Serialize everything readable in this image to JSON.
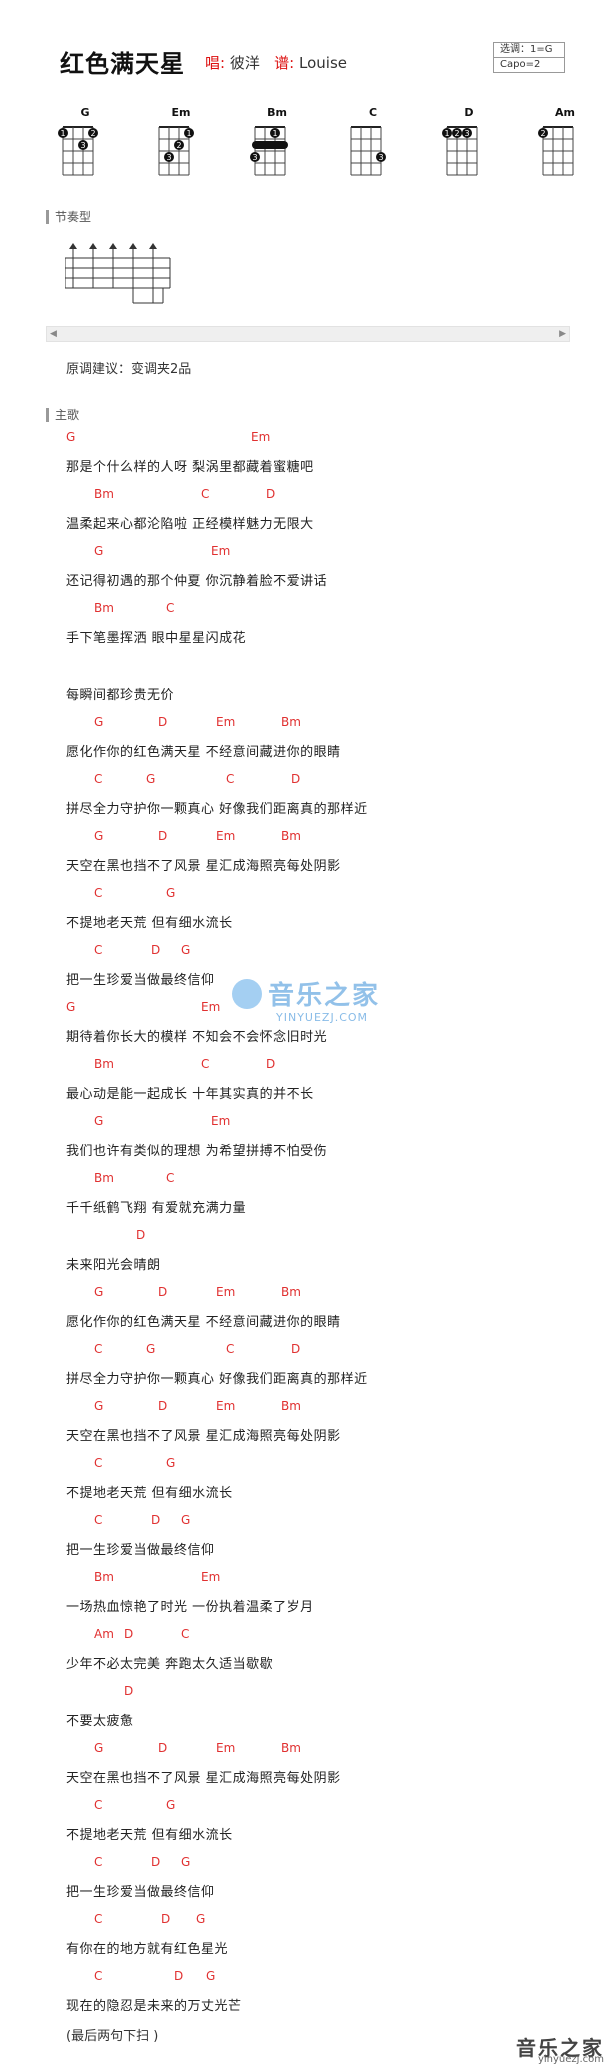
{
  "song": {
    "title": "红色满天星",
    "singer_label": "唱:",
    "singer": "彼洋",
    "score_label": "谱:",
    "scorer": "Louise"
  },
  "key_box": {
    "key": "选调：1=G",
    "capo": "Capo=2"
  },
  "chord_diagrams": [
    {
      "name": "G",
      "dots": [
        {
          "string": 1,
          "fret": 1,
          "finger": "1"
        },
        {
          "string": 4,
          "fret": 1,
          "finger": "2"
        },
        {
          "string": 3,
          "fret": 2,
          "finger": "3"
        }
      ],
      "barre": false
    },
    {
      "name": "Em",
      "dots": [
        {
          "string": 4,
          "fret": 1,
          "finger": "1"
        },
        {
          "string": 3,
          "fret": 2,
          "finger": "2"
        },
        {
          "string": 2,
          "fret": 3,
          "finger": "3"
        }
      ],
      "barre": false
    },
    {
      "name": "Bm",
      "dots": [
        {
          "string": 3,
          "fret": 1,
          "finger": "1"
        },
        {
          "string": 1,
          "fret": 3,
          "finger": "3"
        }
      ],
      "barre": true
    },
    {
      "name": "C",
      "dots": [
        {
          "string": 4,
          "fret": 3,
          "finger": "3"
        }
      ],
      "barre": false
    },
    {
      "name": "D",
      "dots": [
        {
          "string": 1,
          "fret": 1,
          "finger": "1"
        },
        {
          "string": 2,
          "fret": 1,
          "finger": "2"
        },
        {
          "string": 3,
          "fret": 1,
          "finger": "3"
        }
      ],
      "barre": false
    },
    {
      "name": "Am",
      "dots": [
        {
          "string": 1,
          "fret": 1,
          "finger": "2"
        }
      ],
      "barre": false
    }
  ],
  "sections": {
    "rhythm_label": "节奏型",
    "main_label": "主歌"
  },
  "suggestion": "原调建议：变调夹2品",
  "lines": [
    {
      "lyric": "那是个什么样的人呀  梨涡里都藏着蜜糖吧",
      "chords": [
        {
          "c": "G",
          "pos": 0
        },
        {
          "c": "Em",
          "pos": 185
        }
      ]
    },
    {
      "lyric": "温柔起来心都沦陷啦  正经模样魅力无限大",
      "chords": [
        {
          "c": "Bm",
          "pos": 28
        },
        {
          "c": "C",
          "pos": 135
        },
        {
          "c": "D",
          "pos": 200
        }
      ]
    },
    {
      "lyric": "还记得初遇的那个仲夏  你沉静着脸不爱讲话",
      "chords": [
        {
          "c": "G",
          "pos": 28
        },
        {
          "c": "Em",
          "pos": 145
        }
      ]
    },
    {
      "lyric": "手下笔墨挥洒  眼中星星闪成花",
      "chords": [
        {
          "c": "Bm",
          "pos": 28
        },
        {
          "c": "C",
          "pos": 100
        }
      ]
    },
    {
      "lyric": "每瞬间都珍贵无价",
      "chords": []
    },
    {
      "lyric": "愿化作你的红色满天星  不经意间藏进你的眼睛",
      "chords": [
        {
          "c": "G",
          "pos": 28
        },
        {
          "c": "D",
          "pos": 92
        },
        {
          "c": "Em",
          "pos": 150
        },
        {
          "c": "Bm",
          "pos": 215
        }
      ]
    },
    {
      "lyric": "拼尽全力守护你一颗真心  好像我们距离真的那样近",
      "chords": [
        {
          "c": "C",
          "pos": 28
        },
        {
          "c": "G",
          "pos": 80
        },
        {
          "c": "C",
          "pos": 160
        },
        {
          "c": "D",
          "pos": 225
        }
      ]
    },
    {
      "lyric": "天空在黑也挡不了风景  星汇成海照亮每处阴影",
      "chords": [
        {
          "c": "G",
          "pos": 28
        },
        {
          "c": "D",
          "pos": 92
        },
        {
          "c": "Em",
          "pos": 150
        },
        {
          "c": "Bm",
          "pos": 215
        }
      ]
    },
    {
      "lyric": "不提地老天荒  但有细水流长",
      "chords": [
        {
          "c": "C",
          "pos": 28
        },
        {
          "c": "G",
          "pos": 100
        }
      ]
    },
    {
      "lyric": "把一生珍爱当做最终信仰",
      "chords": [
        {
          "c": "C",
          "pos": 28
        },
        {
          "c": "D",
          "pos": 85
        },
        {
          "c": "G",
          "pos": 115
        }
      ]
    },
    {
      "lyric": "期待着你长大的模样  不知会不会怀念旧时光",
      "chords": [
        {
          "c": "G",
          "pos": 0
        },
        {
          "c": "Em",
          "pos": 135
        }
      ]
    },
    {
      "lyric": "最心动是能一起成长  十年其实真的并不长",
      "chords": [
        {
          "c": "Bm",
          "pos": 28
        },
        {
          "c": "C",
          "pos": 135
        },
        {
          "c": "D",
          "pos": 200
        }
      ]
    },
    {
      "lyric": "我们也许有类似的理想  为希望拼搏不怕受伤",
      "chords": [
        {
          "c": "G",
          "pos": 28
        },
        {
          "c": "Em",
          "pos": 145
        }
      ]
    },
    {
      "lyric": "千千纸鹤飞翔  有爱就充满力量",
      "chords": [
        {
          "c": "Bm",
          "pos": 28
        },
        {
          "c": "C",
          "pos": 100
        }
      ]
    },
    {
      "lyric": "未来阳光会晴朗",
      "chords": [
        {
          "c": "D",
          "pos": 70
        }
      ]
    },
    {
      "lyric": "愿化作你的红色满天星  不经意间藏进你的眼睛",
      "chords": [
        {
          "c": "G",
          "pos": 28
        },
        {
          "c": "D",
          "pos": 92
        },
        {
          "c": "Em",
          "pos": 150
        },
        {
          "c": "Bm",
          "pos": 215
        }
      ]
    },
    {
      "lyric": "拼尽全力守护你一颗真心  好像我们距离真的那样近",
      "chords": [
        {
          "c": "C",
          "pos": 28
        },
        {
          "c": "G",
          "pos": 80
        },
        {
          "c": "C",
          "pos": 160
        },
        {
          "c": "D",
          "pos": 225
        }
      ]
    },
    {
      "lyric": "天空在黑也挡不了风景  星汇成海照亮每处阴影",
      "chords": [
        {
          "c": "G",
          "pos": 28
        },
        {
          "c": "D",
          "pos": 92
        },
        {
          "c": "Em",
          "pos": 150
        },
        {
          "c": "Bm",
          "pos": 215
        }
      ]
    },
    {
      "lyric": "不提地老天荒  但有细水流长",
      "chords": [
        {
          "c": "C",
          "pos": 28
        },
        {
          "c": "G",
          "pos": 100
        }
      ]
    },
    {
      "lyric": "把一生珍爱当做最终信仰",
      "chords": [
        {
          "c": "C",
          "pos": 28
        },
        {
          "c": "D",
          "pos": 85
        },
        {
          "c": "G",
          "pos": 115
        }
      ]
    },
    {
      "lyric": "一场热血惊艳了时光  一份执着温柔了岁月",
      "chords": [
        {
          "c": "Bm",
          "pos": 28
        },
        {
          "c": "Em",
          "pos": 135
        }
      ]
    },
    {
      "lyric": "少年不必太完美  奔跑太久适当歇歇",
      "chords": [
        {
          "c": "Am",
          "pos": 28
        },
        {
          "c": "D",
          "pos": 58
        },
        {
          "c": "C",
          "pos": 115
        }
      ]
    },
    {
      "lyric": "不要太疲惫",
      "chords": [
        {
          "c": "D",
          "pos": 58
        }
      ]
    },
    {
      "lyric": "天空在黑也挡不了风景  星汇成海照亮每处阴影",
      "chords": [
        {
          "c": "G",
          "pos": 28
        },
        {
          "c": "D",
          "pos": 92
        },
        {
          "c": "Em",
          "pos": 150
        },
        {
          "c": "Bm",
          "pos": 215
        }
      ]
    },
    {
      "lyric": "不提地老天荒  但有细水流长",
      "chords": [
        {
          "c": "C",
          "pos": 28
        },
        {
          "c": "G",
          "pos": 100
        }
      ]
    },
    {
      "lyric": "把一生珍爱当做最终信仰",
      "chords": [
        {
          "c": "C",
          "pos": 28
        },
        {
          "c": "D",
          "pos": 85
        },
        {
          "c": "G",
          "pos": 115
        }
      ]
    },
    {
      "lyric": "有你在的地方就有红色星光",
      "chords": [
        {
          "c": "C",
          "pos": 28
        },
        {
          "c": "D",
          "pos": 95
        },
        {
          "c": "G",
          "pos": 130
        }
      ]
    },
    {
      "lyric": "现在的隐忍是未来的万丈光芒",
      "chords": [
        {
          "c": "C",
          "pos": 28
        },
        {
          "c": "D",
          "pos": 108
        },
        {
          "c": "G",
          "pos": 140
        }
      ]
    }
  ],
  "ending": "(最后两句下扫 )",
  "watermark": {
    "text": "音乐之家",
    "url": "YINYUEZJ.COM"
  },
  "footer_logo": {
    "text": "音乐之家",
    "url": "yinyuezj.com"
  },
  "colors": {
    "chord": "#e03030",
    "accent": "#d11"
  }
}
